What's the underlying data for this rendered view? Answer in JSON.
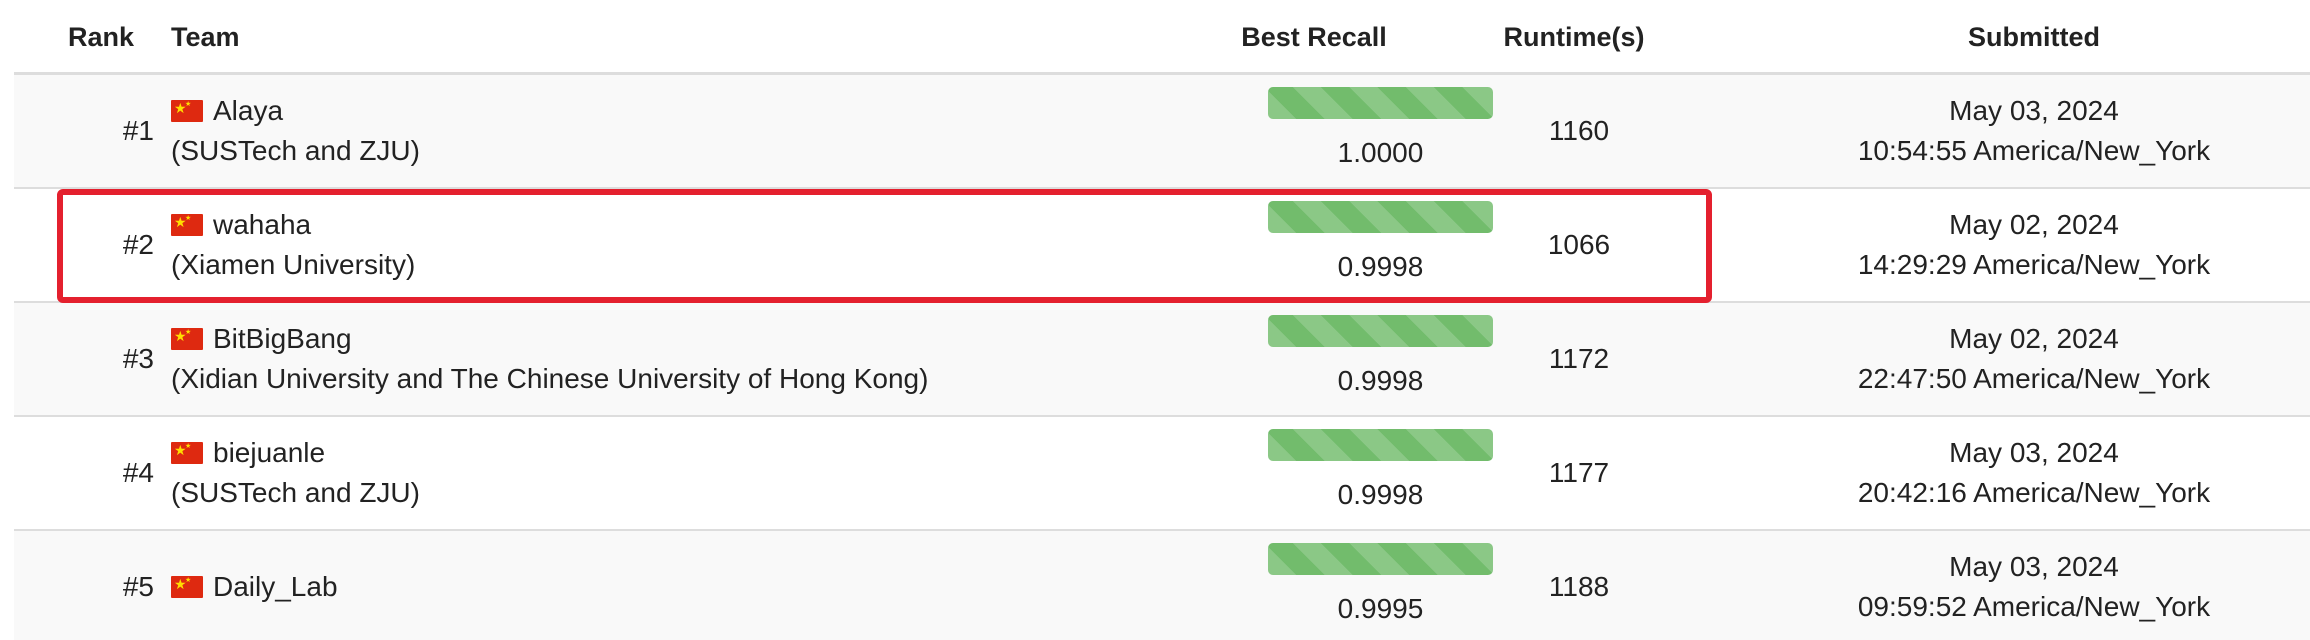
{
  "headers": {
    "rank": "Rank",
    "team": "Team",
    "recall": "Best Recall",
    "runtime": "Runtime(s)",
    "submitted": "Submitted"
  },
  "rows": [
    {
      "rank": "#1",
      "flag": "china-flag-icon",
      "team": "Alaya",
      "affiliation": "(SUSTech and ZJU)",
      "recall": "1.0000",
      "recall_fraction": 1.0,
      "runtime": "1160",
      "date": "May 03, 2024",
      "time": "10:54:55 America/New_York"
    },
    {
      "rank": "#2",
      "flag": "china-flag-icon",
      "team": "wahaha",
      "affiliation": "(Xiamen University)",
      "recall": "0.9998",
      "recall_fraction": 0.9998,
      "runtime": "1066",
      "date": "May 02, 2024",
      "time": "14:29:29 America/New_York"
    },
    {
      "rank": "#3",
      "flag": "china-flag-icon",
      "team": "BitBigBang",
      "affiliation": "(Xidian University and The Chinese University of Hong Kong)",
      "recall": "0.9998",
      "recall_fraction": 0.9998,
      "runtime": "1172",
      "date": "May 02, 2024",
      "time": "22:47:50 America/New_York"
    },
    {
      "rank": "#4",
      "flag": "china-flag-icon",
      "team": "biejuanle",
      "affiliation": "(SUSTech and ZJU)",
      "recall": "0.9998",
      "recall_fraction": 0.9998,
      "runtime": "1177",
      "date": "May 03, 2024",
      "time": "20:42:16 America/New_York"
    },
    {
      "rank": "#5",
      "flag": "china-flag-icon",
      "team": "Daily_Lab",
      "affiliation": "",
      "recall": "0.9995",
      "recall_fraction": 0.9995,
      "runtime": "1188",
      "date": "May 03, 2024",
      "time": "09:59:52 America/New_York"
    }
  ],
  "colors": {
    "bar": "#72bc6c",
    "highlight": "#e4202e",
    "row_alt": "#f9f9f9"
  }
}
